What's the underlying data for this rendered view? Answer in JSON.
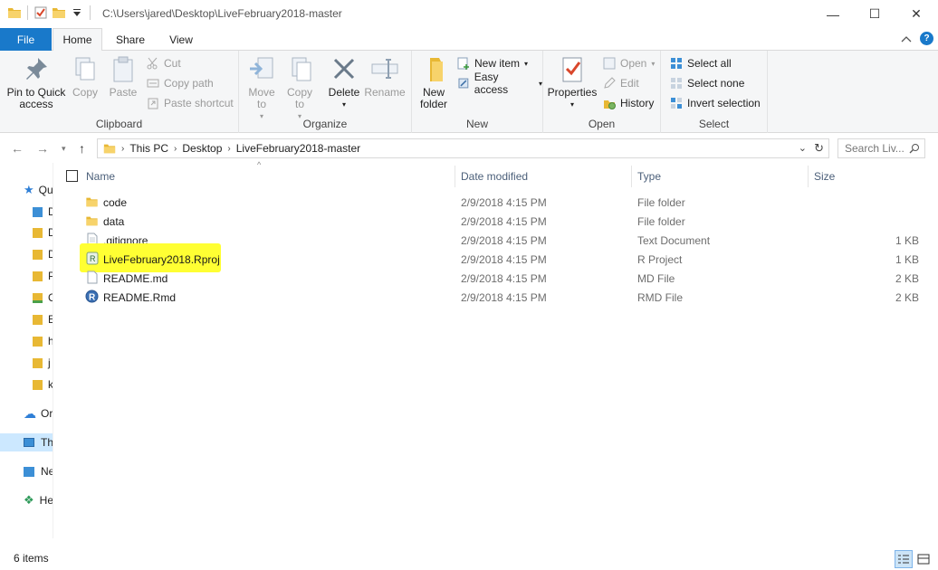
{
  "window": {
    "title": "C:\\Users\\jared\\Desktop\\LiveFebruary2018-master",
    "minimize": "—",
    "maximize": "☐",
    "close": "✕"
  },
  "ribbon_tabs": {
    "file": "File",
    "home": "Home",
    "share": "Share",
    "view": "View",
    "active": "Home",
    "help": "?"
  },
  "clipboard": {
    "label": "Clipboard",
    "pin": "Pin to Quick access",
    "copy": "Copy",
    "paste": "Paste",
    "cut": "Cut",
    "copy_path": "Copy path",
    "paste_shortcut": "Paste shortcut"
  },
  "organize": {
    "label": "Organize",
    "move_to": "Move to",
    "copy_to": "Copy to",
    "delete": "Delete",
    "rename": "Rename"
  },
  "new_group": {
    "label": "New",
    "new_folder": "New folder",
    "new_item": "New item",
    "easy_access": "Easy access"
  },
  "open_group": {
    "label": "Open",
    "properties": "Properties",
    "open": "Open",
    "edit": "Edit",
    "history": "History"
  },
  "select_group": {
    "label": "Select",
    "select_all": "Select all",
    "select_none": "Select none",
    "invert": "Invert selection"
  },
  "address": {
    "crumbs": [
      "This PC",
      "Desktop",
      "LiveFebruary2018-master"
    ],
    "search_placeholder": "Search Liv..."
  },
  "nav_pane": {
    "items": [
      "Qu",
      "D",
      "D",
      "D",
      "P",
      "C",
      "E",
      "h",
      "j",
      "k",
      "Or",
      "Th",
      "Ne",
      "He"
    ]
  },
  "columns": {
    "name": "Name",
    "date": "Date modified",
    "type": "Type",
    "size": "Size"
  },
  "files": [
    {
      "name": "code",
      "date": "2/9/2018 4:15 PM",
      "type": "File folder",
      "size": "",
      "icon": "folder-icon"
    },
    {
      "name": "data",
      "date": "2/9/2018 4:15 PM",
      "type": "File folder",
      "size": "",
      "icon": "folder-icon"
    },
    {
      "name": ".gitignore",
      "date": "2/9/2018 4:15 PM",
      "type": "Text Document",
      "size": "1 KB",
      "icon": "document-icon"
    },
    {
      "name": "LiveFebruary2018.Rproj",
      "date": "2/9/2018 4:15 PM",
      "type": "R Project",
      "size": "1 KB",
      "icon": "rproject-icon",
      "highlighted": true
    },
    {
      "name": "README.md",
      "date": "2/9/2018 4:15 PM",
      "type": "MD File",
      "size": "2 KB",
      "icon": "document-icon"
    },
    {
      "name": "README.Rmd",
      "date": "2/9/2018 4:15 PM",
      "type": "RMD File",
      "size": "2 KB",
      "icon": "r-icon"
    }
  ],
  "status": {
    "count": "6 items"
  },
  "colors": {
    "accent": "#1979ca",
    "highlight": "#ffff33",
    "selected_nav": "#cce8ff"
  }
}
